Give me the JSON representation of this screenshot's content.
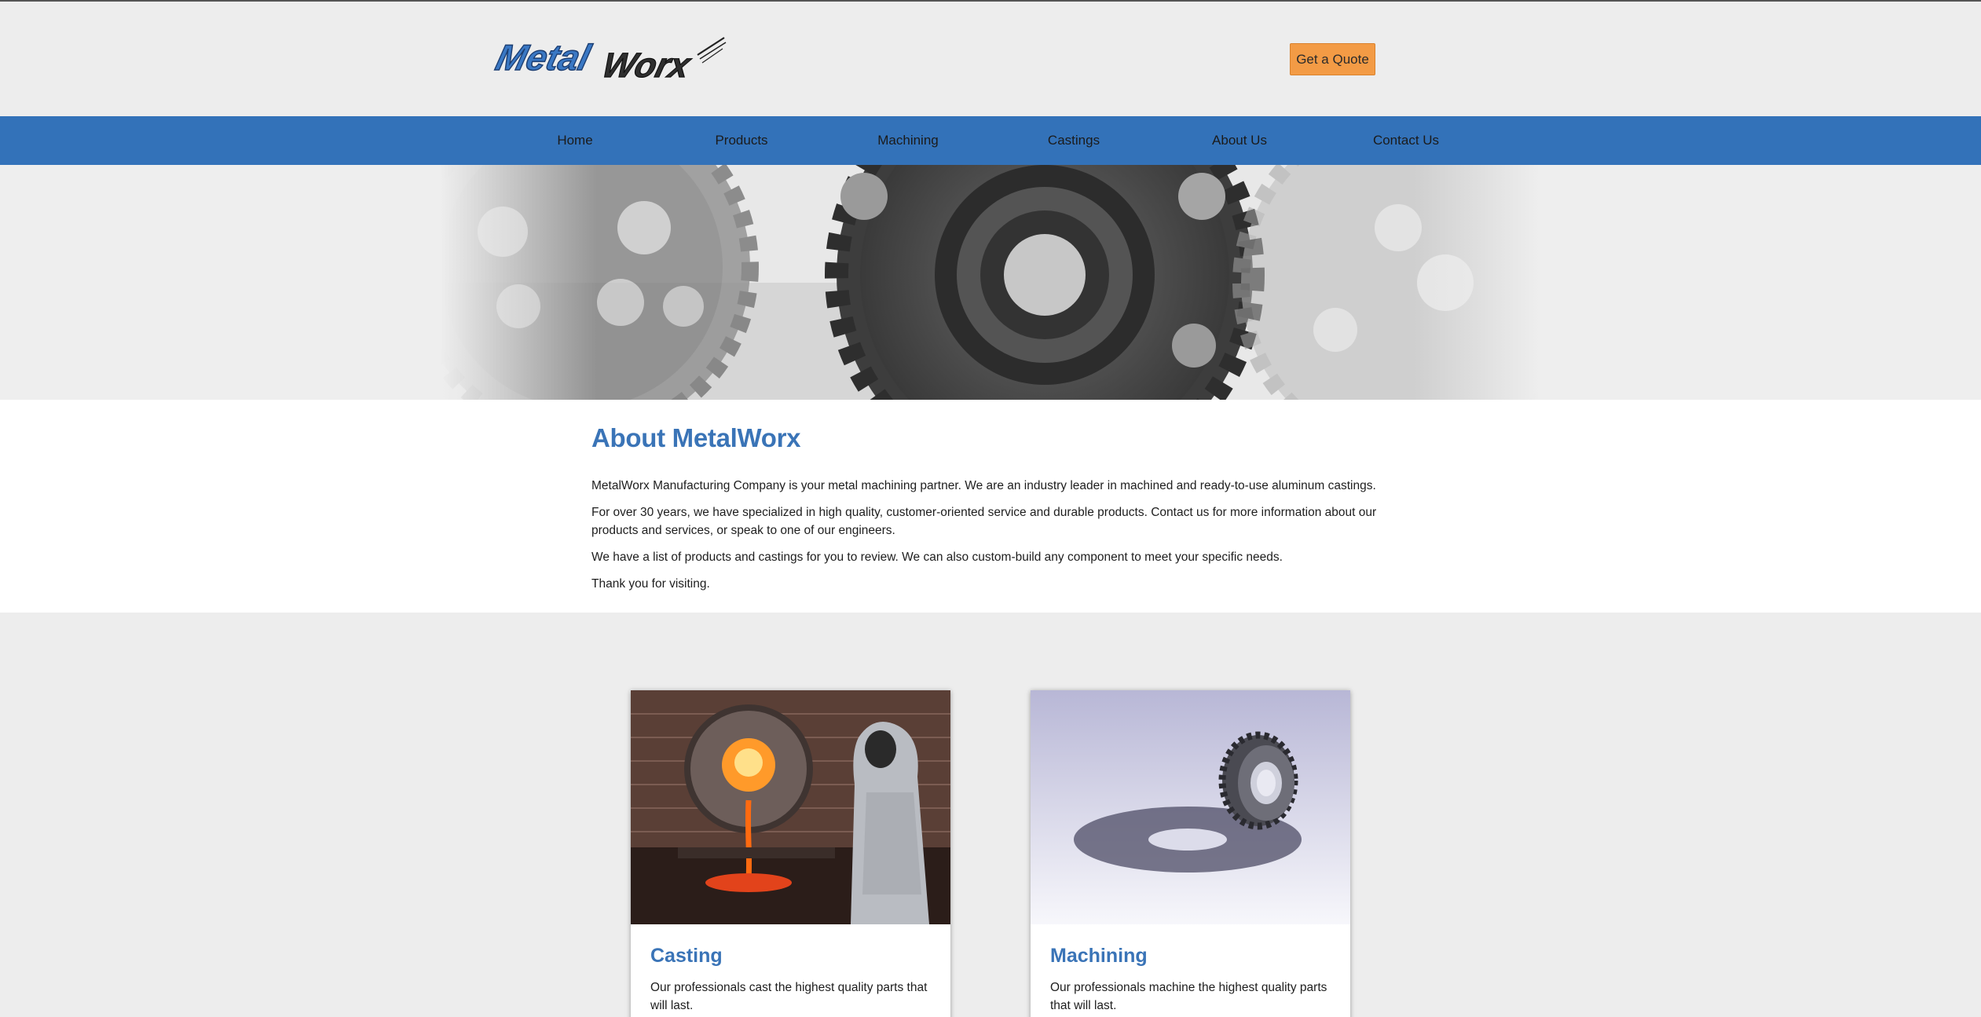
{
  "header": {
    "logo": {
      "part1": "Metal",
      "part2": "Worx"
    },
    "quote_button": "Get a Quote"
  },
  "nav": {
    "items": [
      "Home",
      "Products",
      "Machining",
      "Castings",
      "About Us",
      "Contact Us"
    ]
  },
  "about": {
    "title": "About MetalWorx",
    "paragraphs": [
      "MetalWorx Manufacturing Company is your metal machining partner. We are an industry leader in machined and ready-to-use aluminum castings.",
      "For over 30 years, we have specialized in high quality, customer-oriented service and durable products. Contact us for more information about our products and services, or speak to one of our engineers.",
      "We have a list of products and castings for you to review. We can also custom-build any component to meet your specific needs.",
      "Thank you for visiting."
    ]
  },
  "cards": [
    {
      "title": "Casting",
      "text": "Our professionals cast the highest quality parts that will last."
    },
    {
      "title": "Machining",
      "text": "Our professionals machine the highest quality parts that will last."
    }
  ],
  "colors": {
    "accent": "#3372b9",
    "heading": "#3a74b7",
    "quote_button": "#f39b45",
    "background": "#ededed"
  }
}
